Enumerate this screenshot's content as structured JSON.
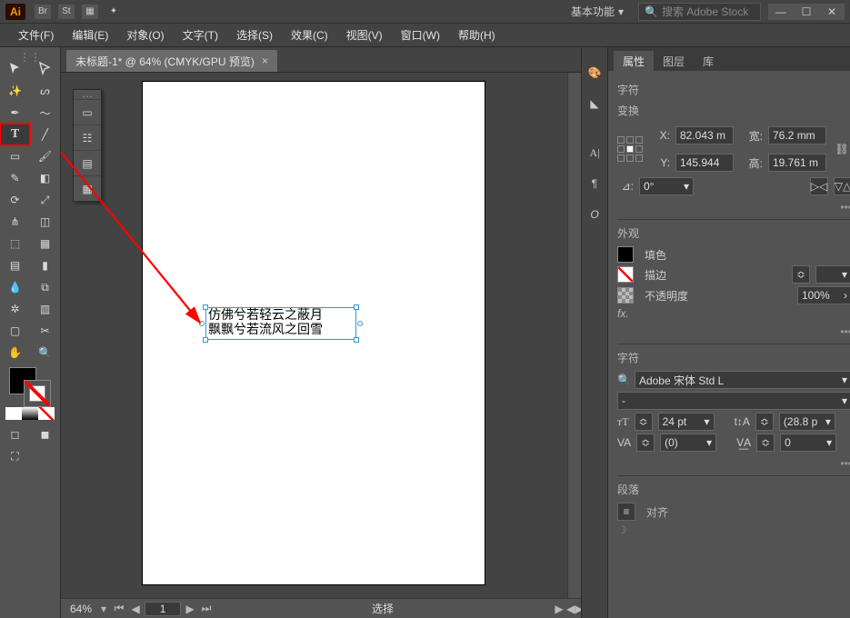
{
  "titlebar": {
    "app_abbrev": "Ai",
    "workspace": "基本功能",
    "search_placeholder": "搜索 Adobe Stock"
  },
  "menu": {
    "file": "文件(F)",
    "edit": "编辑(E)",
    "object": "对象(O)",
    "type": "文字(T)",
    "select": "选择(S)",
    "effect": "效果(C)",
    "view": "视图(V)",
    "window": "窗口(W)",
    "help": "帮助(H)"
  },
  "document": {
    "tab_title": "未标题-1* @ 64% (CMYK/GPU 预览)",
    "zoom": "64%",
    "page_number": "1",
    "status_mode": "选择",
    "text_line1": "仿佛兮若轻云之蔽月",
    "text_line2": "飘飘兮若流风之回雪"
  },
  "panels": {
    "tabs": {
      "properties": "属性",
      "layers": "图层",
      "libraries": "库"
    },
    "char_header": "字符",
    "transform_header": "变换",
    "appearance_header": "外观",
    "character_header": "字符",
    "paragraph_header": "段落",
    "transform": {
      "x_label": "X:",
      "x_value": "82.043 m",
      "y_label": "Y:",
      "y_value": "145.944",
      "w_label": "宽:",
      "w_value": "76.2 mm",
      "h_label": "高:",
      "h_value": "19.761 m",
      "rotate_label": "⊿:",
      "rotate_value": "0°"
    },
    "appearance": {
      "fill_label": "填色",
      "stroke_label": "描边",
      "opacity_label": "不透明度",
      "opacity_value": "100%",
      "fx_label": "fx."
    },
    "character": {
      "font_family": "Adobe 宋体 Std L",
      "font_style": "-",
      "size_value": "24 pt",
      "leading_value": "(28.8 p",
      "tracking_value": "(0)",
      "kerning_value": "0"
    },
    "paragraph_sub": "对齐"
  }
}
